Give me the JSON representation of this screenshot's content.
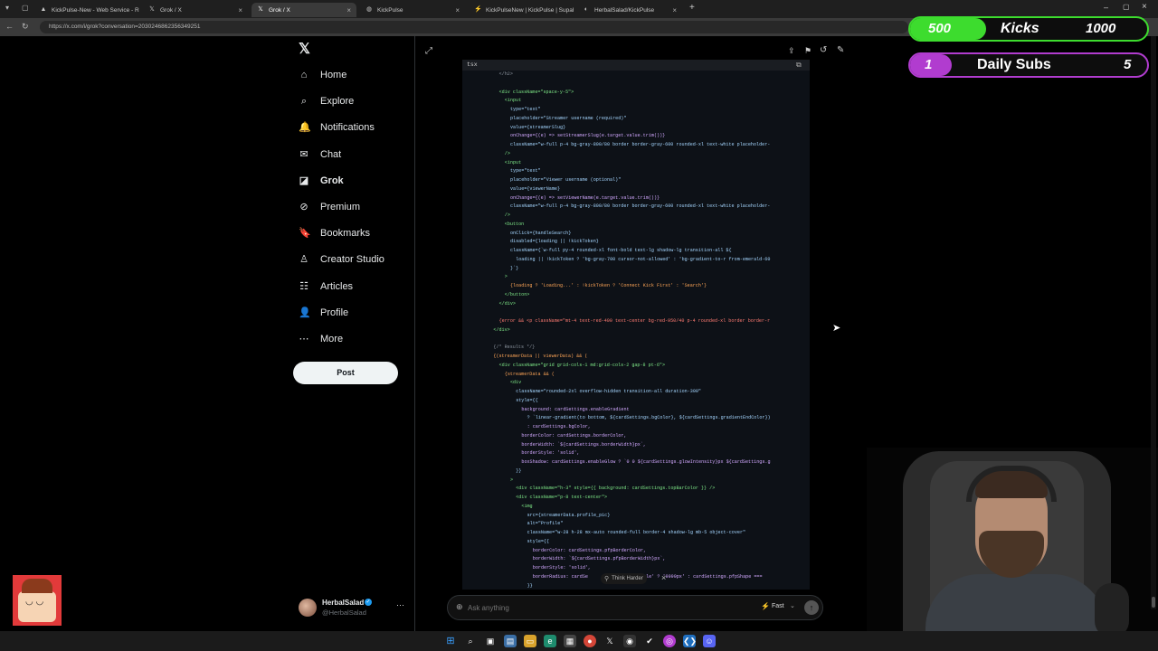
{
  "browser": {
    "tabs": [
      {
        "title": "KickPulse-New - Web Service - Re",
        "icon": "render-icon",
        "active": false
      },
      {
        "title": "Grok / X",
        "icon": "x-icon",
        "active": false
      },
      {
        "title": "Grok / X",
        "icon": "x-icon",
        "active": true
      },
      {
        "title": "KickPulse",
        "icon": "globe-icon",
        "active": false
      },
      {
        "title": "KickPulseNew | KickPulse | Supab",
        "icon": "supabase-icon",
        "active": false
      },
      {
        "title": "HerbalSalad/KickPulse",
        "icon": "github-icon",
        "active": false
      }
    ],
    "new_tab": "+",
    "url": "https://x.com/i/grok?conversation=2030246862356349251"
  },
  "sidebar": {
    "logo": "𝕏",
    "items": [
      {
        "label": "Home",
        "icon": "home-icon",
        "glyph": "⌂"
      },
      {
        "label": "Explore",
        "icon": "search-icon",
        "glyph": "⌕"
      },
      {
        "label": "Notifications",
        "icon": "bell-icon",
        "glyph": "🔔"
      },
      {
        "label": "Chat",
        "icon": "mail-icon",
        "glyph": "✉"
      },
      {
        "label": "Grok",
        "icon": "grok-icon",
        "glyph": "◪"
      },
      {
        "label": "Premium",
        "icon": "premium-icon",
        "glyph": "⊘"
      },
      {
        "label": "Bookmarks",
        "icon": "bookmark-icon",
        "glyph": "🔖"
      },
      {
        "label": "Creator Studio",
        "icon": "creator-icon",
        "glyph": "♙"
      },
      {
        "label": "Articles",
        "icon": "articles-icon",
        "glyph": "☷"
      },
      {
        "label": "Profile",
        "icon": "profile-icon",
        "glyph": "👤"
      },
      {
        "label": "More",
        "icon": "more-icon",
        "glyph": "⋯"
      }
    ],
    "post_label": "Post",
    "account": {
      "name": "HerbalSalad",
      "handle": "@HerbalSalad",
      "menu": "···"
    }
  },
  "code": {
    "language": "tsx",
    "lines": [
      {
        "i": 6,
        "t": "</h2>",
        "c": "#8b949e"
      },
      {
        "i": 0,
        "t": "",
        "c": "#c9d1d9"
      },
      {
        "i": 6,
        "t": "<div className=\"space-y-5\">",
        "c": "#7ee787"
      },
      {
        "i": 8,
        "t": "<input",
        "c": "#7ee787"
      },
      {
        "i": 10,
        "t": "type=\"text\"",
        "c": "#a5d6ff"
      },
      {
        "i": 10,
        "t": "placeholder=\"Streamer username (required)\"",
        "c": "#a5d6ff"
      },
      {
        "i": 10,
        "t": "value={streamerSlug}",
        "c": "#a5d6ff"
      },
      {
        "i": 10,
        "t": "onChange={(e) => setStreamerSlug(e.target.value.trim())}",
        "c": "#d2a8ff"
      },
      {
        "i": 10,
        "t": "className=\"w-full p-4 bg-gray-800/80 border border-gray-600 rounded-xl text-white placeholder-",
        "c": "#a5d6ff"
      },
      {
        "i": 8,
        "t": "/>",
        "c": "#7ee787"
      },
      {
        "i": 8,
        "t": "<input",
        "c": "#7ee787"
      },
      {
        "i": 10,
        "t": "type=\"text\"",
        "c": "#a5d6ff"
      },
      {
        "i": 10,
        "t": "placeholder=\"Viewer username (optional)\"",
        "c": "#a5d6ff"
      },
      {
        "i": 10,
        "t": "value={viewerName}",
        "c": "#a5d6ff"
      },
      {
        "i": 10,
        "t": "onChange={(e) => setViewerName(e.target.value.trim())}",
        "c": "#d2a8ff"
      },
      {
        "i": 10,
        "t": "className=\"w-full p-4 bg-gray-800/80 border border-gray-600 rounded-xl text-white placeholder-",
        "c": "#a5d6ff"
      },
      {
        "i": 8,
        "t": "/>",
        "c": "#7ee787"
      },
      {
        "i": 8,
        "t": "<button",
        "c": "#7ee787"
      },
      {
        "i": 10,
        "t": "onClick={handleSearch}",
        "c": "#a5d6ff"
      },
      {
        "i": 10,
        "t": "disabled={loading || !kickToken}",
        "c": "#a5d6ff"
      },
      {
        "i": 10,
        "t": "className={`w-full py-4 rounded-xl font-bold text-lg shadow-lg transition-all ${",
        "c": "#a5d6ff"
      },
      {
        "i": 12,
        "t": "loading || !kickToken ? 'bg-gray-700 cursor-not-allowed' : 'bg-gradient-to-r from-emerald-60",
        "c": "#a5d6ff"
      },
      {
        "i": 10,
        "t": "}`}",
        "c": "#a5d6ff"
      },
      {
        "i": 8,
        "t": ">",
        "c": "#7ee787"
      },
      {
        "i": 10,
        "t": "{loading ? 'Loading...' : !kickToken ? 'Connect Kick First' : 'Search'}",
        "c": "#ffa657"
      },
      {
        "i": 8,
        "t": "</button>",
        "c": "#7ee787"
      },
      {
        "i": 6,
        "t": "</div>",
        "c": "#7ee787"
      },
      {
        "i": 0,
        "t": "",
        "c": "#c9d1d9"
      },
      {
        "i": 6,
        "t": "{error && <p className=\"mt-4 text-red-400 text-center bg-red-950/40 p-4 rounded-xl border border-r",
        "c": "#ff7b72"
      },
      {
        "i": 4,
        "t": "</div>",
        "c": "#7ee787"
      },
      {
        "i": 0,
        "t": "",
        "c": "#c9d1d9"
      },
      {
        "i": 4,
        "t": "{/* Results */}",
        "c": "#8b949e"
      },
      {
        "i": 4,
        "t": "{(streamerData || viewerData) && (",
        "c": "#ffa657"
      },
      {
        "i": 6,
        "t": "<div className=\"grid grid-cols-1 md:grid-cols-2 gap-8 pt-6\">",
        "c": "#7ee787"
      },
      {
        "i": 8,
        "t": "{streamerData && (",
        "c": "#ffa657"
      },
      {
        "i": 10,
        "t": "<div",
        "c": "#7ee787"
      },
      {
        "i": 12,
        "t": "className=\"rounded-2xl overflow-hidden transition-all duration-300\"",
        "c": "#a5d6ff"
      },
      {
        "i": 12,
        "t": "style={{",
        "c": "#a5d6ff"
      },
      {
        "i": 14,
        "t": "background: cardSettings.enableGradient",
        "c": "#d2a8ff"
      },
      {
        "i": 16,
        "t": "? `linear-gradient(to bottom, ${cardSettings.bgColor}, ${cardSettings.gradientEndColor})",
        "c": "#a5d6ff"
      },
      {
        "i": 16,
        "t": ": cardSettings.bgColor,",
        "c": "#d2a8ff"
      },
      {
        "i": 14,
        "t": "borderColor: cardSettings.borderColor,",
        "c": "#d2a8ff"
      },
      {
        "i": 14,
        "t": "borderWidth: `${cardSettings.borderWidth}px`,",
        "c": "#d2a8ff"
      },
      {
        "i": 14,
        "t": "borderStyle: 'solid',",
        "c": "#d2a8ff"
      },
      {
        "i": 14,
        "t": "boxShadow: cardSettings.enableGlow ? `0 0 ${cardSettings.glowIntensity}px ${cardSettings.g",
        "c": "#d2a8ff"
      },
      {
        "i": 12,
        "t": "}}",
        "c": "#a5d6ff"
      },
      {
        "i": 10,
        "t": ">",
        "c": "#7ee787"
      },
      {
        "i": 12,
        "t": "<div className=\"h-3\" style={{ background: cardSettings.topBarColor }} />",
        "c": "#7ee787"
      },
      {
        "i": 12,
        "t": "<div className=\"p-8 text-center\">",
        "c": "#7ee787"
      },
      {
        "i": 14,
        "t": "<img",
        "c": "#7ee787"
      },
      {
        "i": 16,
        "t": "src={streamerData.profile_pic}",
        "c": "#a5d6ff"
      },
      {
        "i": 16,
        "t": "alt=\"Profile\"",
        "c": "#a5d6ff"
      },
      {
        "i": 16,
        "t": "className=\"w-28 h-28 mx-auto rounded-full border-4 shadow-lg mb-5 object-cover\"",
        "c": "#a5d6ff"
      },
      {
        "i": 16,
        "t": "style={{",
        "c": "#a5d6ff"
      },
      {
        "i": 18,
        "t": "borderColor: cardSettings.pfpBorderColor,",
        "c": "#d2a8ff"
      },
      {
        "i": 18,
        "t": "borderWidth: `${cardSettings.pfpBorderWidth}px`,",
        "c": "#d2a8ff"
      },
      {
        "i": 18,
        "t": "borderStyle: 'solid',",
        "c": "#d2a8ff"
      },
      {
        "i": 18,
        "t": "borderRadius: cardSe                    cle' ? '9999px' : cardSettings.pfpShape ===",
        "c": "#d2a8ff"
      },
      {
        "i": 16,
        "t": "}}",
        "c": "#a5d6ff"
      }
    ],
    "think_harder": "Think Harder",
    "think_close": "×"
  },
  "chat": {
    "placeholder": "Ask anything",
    "mode": "Fast",
    "attach": "⊕",
    "send": "↑"
  },
  "overlays": {
    "kicks": {
      "left": "500",
      "label": "Kicks",
      "right": "1000"
    },
    "subs": {
      "left": "1",
      "label": "Daily Subs",
      "right": "5"
    }
  },
  "colors": {
    "kicks_green": "#3ddc2e",
    "subs_purple": "#b13ccf",
    "x_bg": "#000000",
    "code_bg": "#0d1117"
  }
}
